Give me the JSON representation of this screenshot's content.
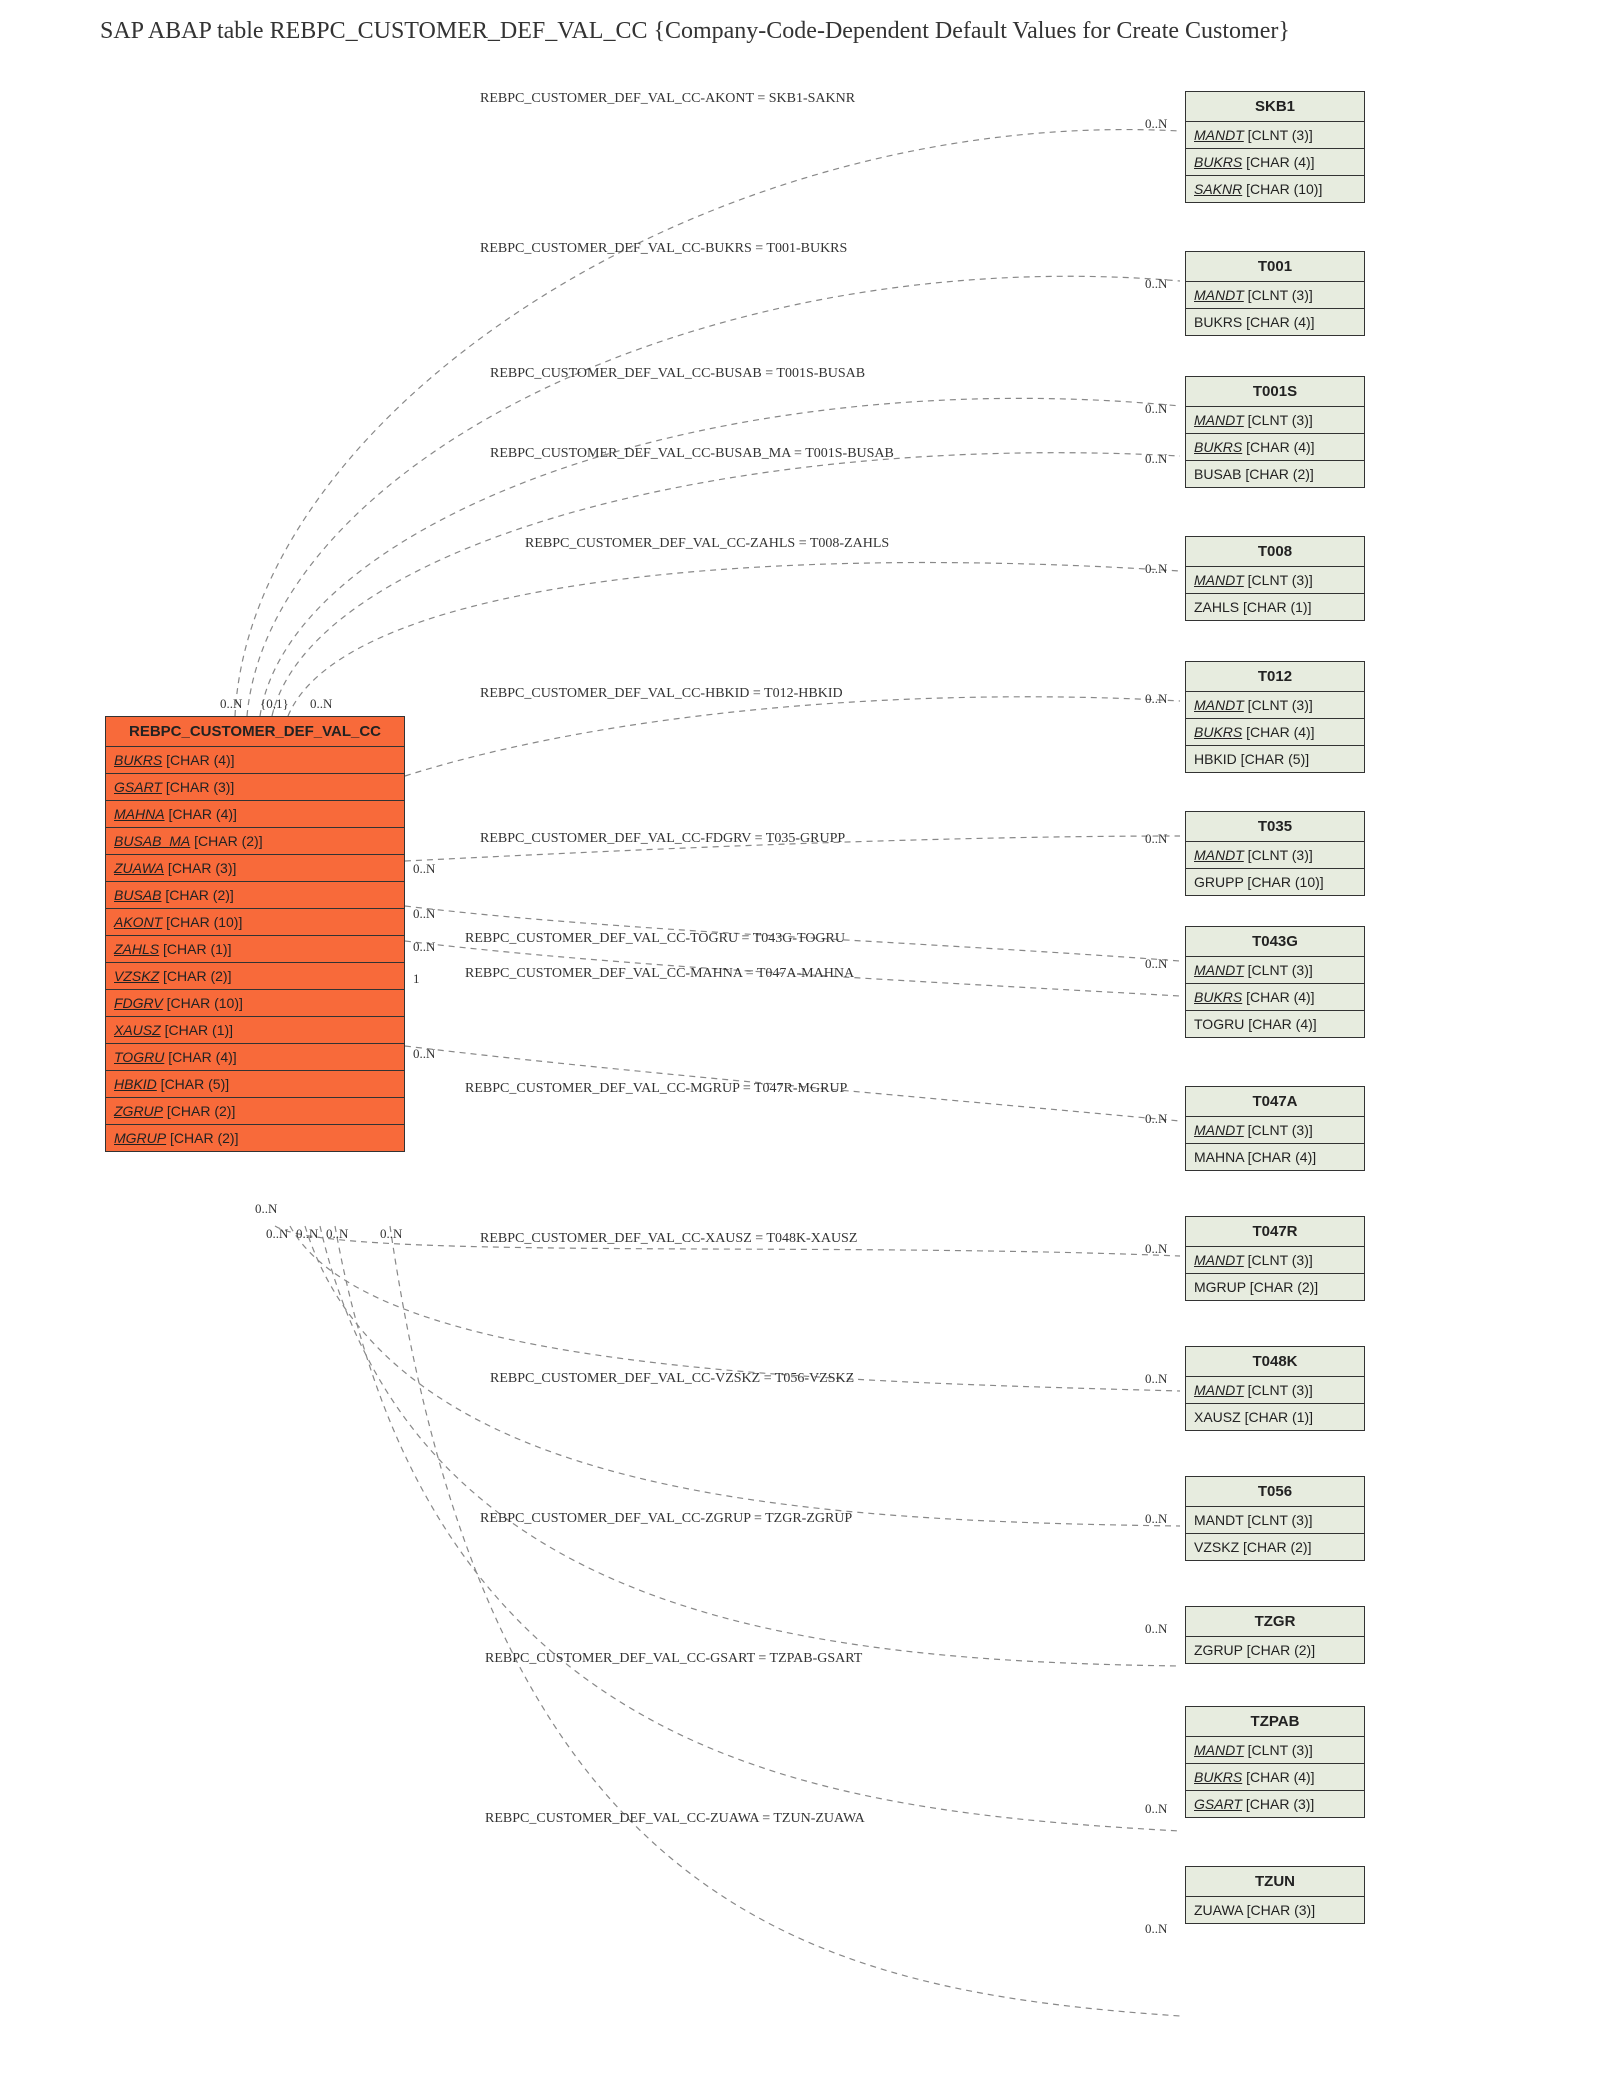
{
  "title": "SAP ABAP table REBPC_CUSTOMER_DEF_VAL_CC {Company-Code-Dependent Default Values for Create Customer}",
  "main_entity": {
    "name": "REBPC_CUSTOMER_DEF_VAL_CC",
    "fields": [
      {
        "name": "BUKRS",
        "type": "[CHAR (4)]",
        "fk": true
      },
      {
        "name": "GSART",
        "type": "[CHAR (3)]",
        "fk": true
      },
      {
        "name": "MAHNA",
        "type": "[CHAR (4)]",
        "fk": true
      },
      {
        "name": "BUSAB_MA",
        "type": "[CHAR (2)]",
        "fk": true
      },
      {
        "name": "ZUAWA",
        "type": "[CHAR (3)]",
        "fk": true
      },
      {
        "name": "BUSAB",
        "type": "[CHAR (2)]",
        "fk": true
      },
      {
        "name": "AKONT",
        "type": "[CHAR (10)]",
        "fk": true
      },
      {
        "name": "ZAHLS",
        "type": "[CHAR (1)]",
        "fk": true
      },
      {
        "name": "VZSKZ",
        "type": "[CHAR (2)]",
        "fk": true
      },
      {
        "name": "FDGRV",
        "type": "[CHAR (10)]",
        "fk": true
      },
      {
        "name": "XAUSZ",
        "type": "[CHAR (1)]",
        "fk": true
      },
      {
        "name": "TOGRU",
        "type": "[CHAR (4)]",
        "fk": true
      },
      {
        "name": "HBKID",
        "type": "[CHAR (5)]",
        "fk": true
      },
      {
        "name": "ZGRUP",
        "type": "[CHAR (2)]",
        "fk": true
      },
      {
        "name": "MGRUP",
        "type": "[CHAR (2)]",
        "fk": true
      }
    ]
  },
  "targets": [
    {
      "name": "SKB1",
      "fields": [
        {
          "name": "MANDT",
          "type": "[CLNT (3)]",
          "fk": true
        },
        {
          "name": "BUKRS",
          "type": "[CHAR (4)]",
          "fk": true
        },
        {
          "name": "SAKNR",
          "type": "[CHAR (10)]",
          "fk": true
        }
      ]
    },
    {
      "name": "T001",
      "fields": [
        {
          "name": "MANDT",
          "type": "[CLNT (3)]",
          "fk": true
        },
        {
          "name": "BUKRS",
          "type": "[CHAR (4)]",
          "fk": false
        }
      ]
    },
    {
      "name": "T001S",
      "fields": [
        {
          "name": "MANDT",
          "type": "[CLNT (3)]",
          "fk": true
        },
        {
          "name": "BUKRS",
          "type": "[CHAR (4)]",
          "fk": true
        },
        {
          "name": "BUSAB",
          "type": "[CHAR (2)]",
          "fk": false
        }
      ]
    },
    {
      "name": "T008",
      "fields": [
        {
          "name": "MANDT",
          "type": "[CLNT (3)]",
          "fk": true
        },
        {
          "name": "ZAHLS",
          "type": "[CHAR (1)]",
          "fk": false
        }
      ]
    },
    {
      "name": "T012",
      "fields": [
        {
          "name": "MANDT",
          "type": "[CLNT (3)]",
          "fk": true
        },
        {
          "name": "BUKRS",
          "type": "[CHAR (4)]",
          "fk": true
        },
        {
          "name": "HBKID",
          "type": "[CHAR (5)]",
          "fk": false
        }
      ]
    },
    {
      "name": "T035",
      "fields": [
        {
          "name": "MANDT",
          "type": "[CLNT (3)]",
          "fk": true
        },
        {
          "name": "GRUPP",
          "type": "[CHAR (10)]",
          "fk": false
        }
      ]
    },
    {
      "name": "T043G",
      "fields": [
        {
          "name": "MANDT",
          "type": "[CLNT (3)]",
          "fk": true
        },
        {
          "name": "BUKRS",
          "type": "[CHAR (4)]",
          "fk": true
        },
        {
          "name": "TOGRU",
          "type": "[CHAR (4)]",
          "fk": false
        }
      ]
    },
    {
      "name": "T047A",
      "fields": [
        {
          "name": "MANDT",
          "type": "[CLNT (3)]",
          "fk": true
        },
        {
          "name": "MAHNA",
          "type": "[CHAR (4)]",
          "fk": false
        }
      ]
    },
    {
      "name": "T047R",
      "fields": [
        {
          "name": "MANDT",
          "type": "[CLNT (3)]",
          "fk": true
        },
        {
          "name": "MGRUP",
          "type": "[CHAR (2)]",
          "fk": false
        }
      ]
    },
    {
      "name": "T048K",
      "fields": [
        {
          "name": "MANDT",
          "type": "[CLNT (3)]",
          "fk": true
        },
        {
          "name": "XAUSZ",
          "type": "[CHAR (1)]",
          "fk": false
        }
      ]
    },
    {
      "name": "T056",
      "fields": [
        {
          "name": "MANDT",
          "type": "[CLNT (3)]",
          "fk": false
        },
        {
          "name": "VZSKZ",
          "type": "[CHAR (2)]",
          "fk": false
        }
      ]
    },
    {
      "name": "TZGR",
      "fields": [
        {
          "name": "ZGRUP",
          "type": "[CHAR (2)]",
          "fk": false
        }
      ]
    },
    {
      "name": "TZPAB",
      "fields": [
        {
          "name": "MANDT",
          "type": "[CLNT (3)]",
          "fk": true
        },
        {
          "name": "BUKRS",
          "type": "[CHAR (4)]",
          "fk": true
        },
        {
          "name": "GSART",
          "type": "[CHAR (3)]",
          "fk": true
        }
      ]
    },
    {
      "name": "TZUN",
      "fields": [
        {
          "name": "ZUAWA",
          "type": "[CHAR (3)]",
          "fk": false
        }
      ]
    }
  ],
  "relations": [
    {
      "label": "REBPC_CUSTOMER_DEF_VAL_CC-AKONT = SKB1-SAKNR",
      "rcard": "0..N"
    },
    {
      "label": "REBPC_CUSTOMER_DEF_VAL_CC-BUKRS = T001-BUKRS",
      "rcard": "0..N"
    },
    {
      "label": "REBPC_CUSTOMER_DEF_VAL_CC-BUSAB = T001S-BUSAB",
      "rcard": "0..N"
    },
    {
      "label": "REBPC_CUSTOMER_DEF_VAL_CC-BUSAB_MA = T001S-BUSAB",
      "rcard": "0..N"
    },
    {
      "label": "REBPC_CUSTOMER_DEF_VAL_CC-ZAHLS = T008-ZAHLS",
      "rcard": "0..N"
    },
    {
      "label": "REBPC_CUSTOMER_DEF_VAL_CC-HBKID = T012-HBKID",
      "rcard": "0..N"
    },
    {
      "label": "REBPC_CUSTOMER_DEF_VAL_CC-FDGRV = T035-GRUPP",
      "rcard": "0..N"
    },
    {
      "label": "REBPC_CUSTOMER_DEF_VAL_CC-TOGRU = T043G-TOGRU",
      "rcard": "0..N"
    },
    {
      "label": "REBPC_CUSTOMER_DEF_VAL_CC-MAHNA = T047A-MAHNA",
      "rcard": "1"
    },
    {
      "label": "REBPC_CUSTOMER_DEF_VAL_CC-MGRUP = T047R-MGRUP",
      "rcard": "0..N"
    },
    {
      "label": "REBPC_CUSTOMER_DEF_VAL_CC-XAUSZ = T048K-XAUSZ",
      "rcard": "0..N"
    },
    {
      "label": "REBPC_CUSTOMER_DEF_VAL_CC-VZSKZ = T056-VZSKZ",
      "rcard": "0..N"
    },
    {
      "label": "REBPC_CUSTOMER_DEF_VAL_CC-ZGRUP = TZGR-ZGRUP",
      "rcard": "0..N"
    },
    {
      "label": "REBPC_CUSTOMER_DEF_VAL_CC-GSART = TZPAB-GSART",
      "rcard": "0..N"
    },
    {
      "label": "REBPC_CUSTOMER_DEF_VAL_CC-ZUAWA = TZUN-ZUAWA",
      "rcard": "0..N"
    }
  ],
  "left_cards_top": [
    "0..N",
    "{0,1}",
    "0..N"
  ],
  "left_cards_mid": [
    "0..N",
    "0..N",
    "0..N",
    "1",
    "0..N"
  ],
  "left_cards_bot": [
    "0..N",
    "0..N",
    "0..N",
    "0..N",
    "0..N",
    "0..N"
  ],
  "chart_data": {
    "type": "table",
    "note": "Entity-relationship diagram for SAP ABAP table REBPC_CUSTOMER_DEF_VAL_CC showing foreign-key dependencies to 14 other tables with cardinalities."
  }
}
